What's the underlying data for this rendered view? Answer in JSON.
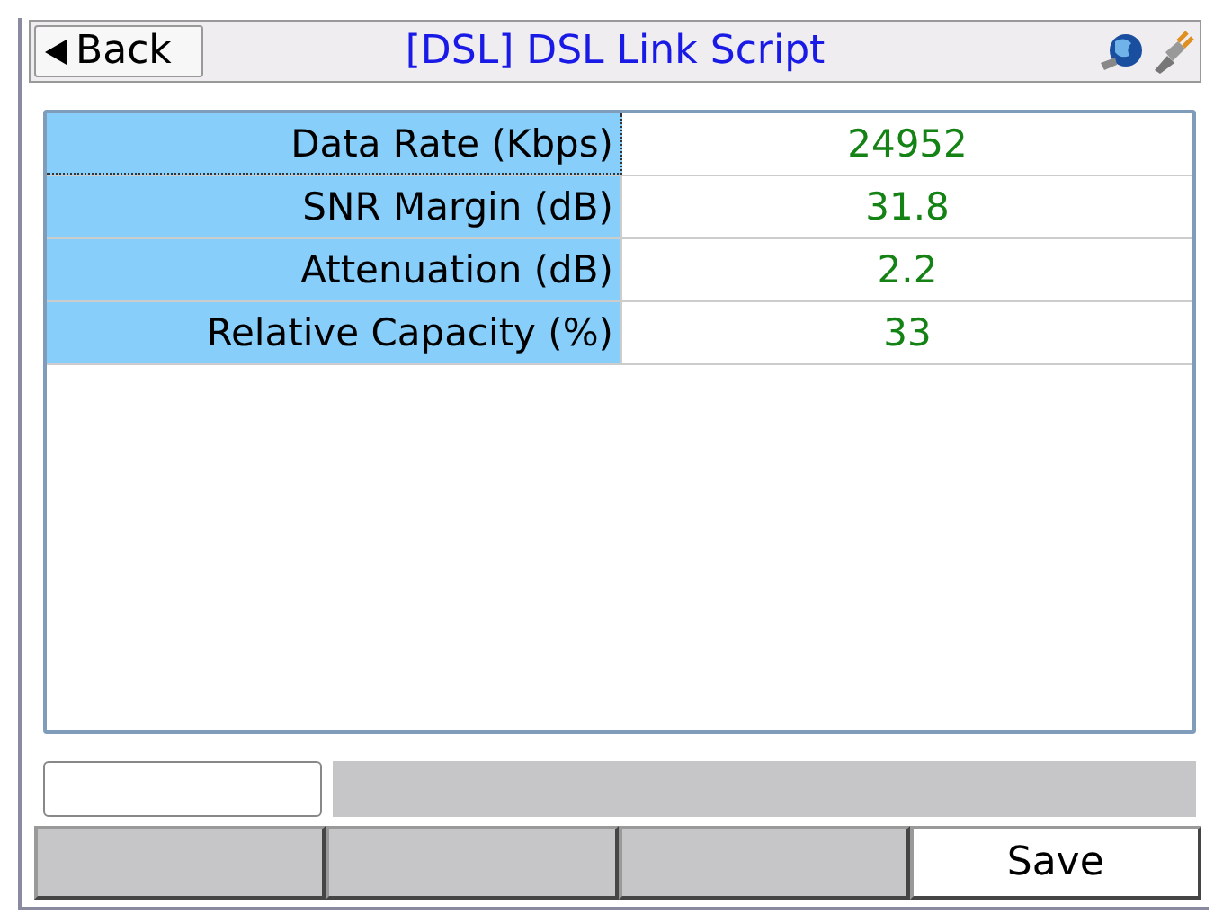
{
  "header": {
    "back": "Back",
    "title": "[DSL] DSL Link Script"
  },
  "table": {
    "rows": [
      {
        "label": "Data Rate (Kbps)",
        "value": "24952",
        "focused": true
      },
      {
        "label": "SNR Margin (dB)",
        "value": "31.8",
        "focused": false
      },
      {
        "label": "Attenuation (dB)",
        "value": "2.2",
        "focused": false
      },
      {
        "label": "Relative Capacity (%)",
        "value": "33",
        "focused": false
      }
    ]
  },
  "softkeys": [
    {
      "disabled": true
    },
    {
      "disabled": true
    },
    {
      "disabled": true
    },
    {
      "label": "Save",
      "disabled": false
    }
  ]
}
